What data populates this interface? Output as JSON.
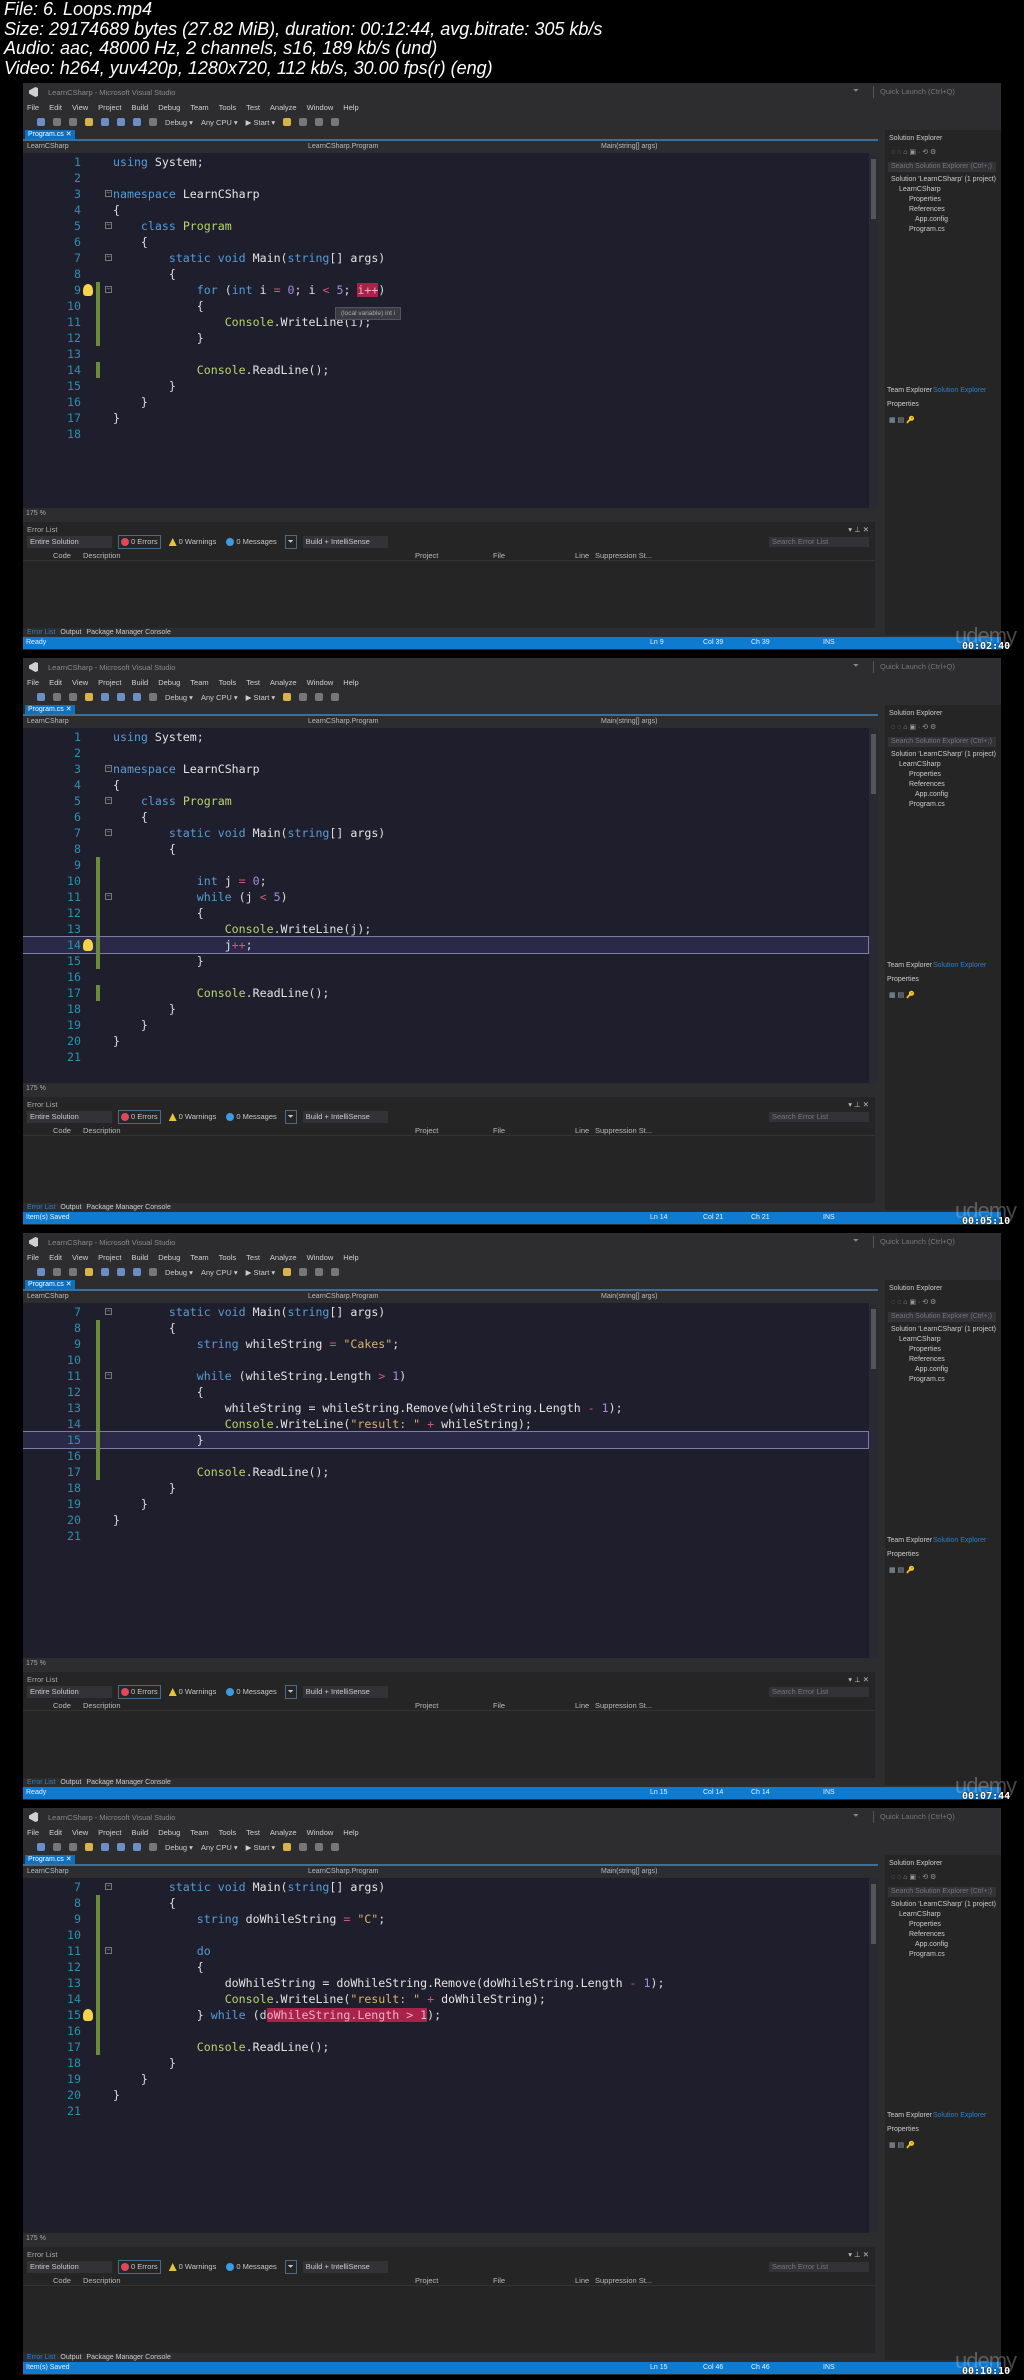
{
  "file_info": {
    "file": "File: 6. Loops.mp4",
    "size": "Size: 29174689 bytes (27.82 MiB), duration: 00:12:44, avg.bitrate: 305 kb/s",
    "audio": "Audio: aac, 48000 Hz, 2 channels, s16, 189 kb/s (und)",
    "video": "Video: h264, yuv420p, 1280x720, 112 kb/s, 30.00 fps(r) (eng)"
  },
  "ide": {
    "title": "LearnCSharp - Microsoft Visual Studio",
    "quick_launch": "Quick Launch (Ctrl+Q)",
    "menu": [
      "File",
      "Edit",
      "View",
      "Project",
      "Build",
      "Debug",
      "Team",
      "Tools",
      "Test",
      "Analyze",
      "Window",
      "Help"
    ],
    "config": "Debug ▾",
    "platform": "Any CPU ▾",
    "start": "▶ Start ▾",
    "doc_tab": "Program.cs  ✕",
    "nav_project": "LearnCSharp",
    "nav_class": "LearnCSharp.Program",
    "nav_member": "Main(string[] args)",
    "zoom": "175 %",
    "error_list": {
      "title": "Error List",
      "scope": "Entire Solution",
      "errors": "0 Errors",
      "warnings": "0 Warnings",
      "messages": "0 Messages",
      "build_filter": "Build + IntelliSense",
      "search": "Search Error List",
      "columns": [
        "Code",
        "Description",
        "Project",
        "File",
        "Line",
        "Suppression St..."
      ]
    },
    "bottom_tabs": [
      "Error List",
      "Output",
      "Package Manager Console"
    ],
    "solution_explorer": {
      "title": "Solution Explorer",
      "search": "Search Solution Explorer (Ctrl+;)",
      "tree": [
        "Solution 'LearnCSharp' (1 project)",
        "LearnCSharp",
        "Properties",
        "References",
        "App.config",
        "Program.cs"
      ],
      "tabs": [
        "Team Explorer",
        "Solution Explorer"
      ],
      "properties": "Properties"
    },
    "ins": "INS",
    "watermark": "udemy"
  },
  "frames": [
    {
      "timestamp": "00:02:40",
      "status": "Ready",
      "ln": "Ln 9",
      "col": "Col 39",
      "ch": "Ch 39",
      "first_line": 1,
      "current_line": 0,
      "bulb_line": 9,
      "changed_lines": [
        9,
        10,
        11,
        12,
        14
      ],
      "fold_lines": [
        3,
        5,
        7,
        9
      ],
      "tooltip": "(local variable) int i",
      "code": [
        [
          [
            "k",
            "using"
          ],
          [
            "p",
            " "
          ],
          [
            "i",
            "System"
          ],
          [
            "p",
            ";"
          ]
        ],
        [],
        [
          [
            "k",
            "namespace"
          ],
          [
            "p",
            " "
          ],
          [
            "i",
            "LearnCSharp"
          ]
        ],
        [
          [
            "p",
            "{"
          ]
        ],
        [
          [
            "p",
            "    "
          ],
          [
            "k",
            "class"
          ],
          [
            "p",
            " "
          ],
          [
            "t",
            "Program"
          ]
        ],
        [
          [
            "p",
            "    {"
          ]
        ],
        [
          [
            "p",
            "        "
          ],
          [
            "k",
            "static"
          ],
          [
            "p",
            " "
          ],
          [
            "k",
            "void"
          ],
          [
            "p",
            " "
          ],
          [
            "i",
            "Main"
          ],
          [
            "p",
            "("
          ],
          [
            "k",
            "string"
          ],
          [
            "p",
            "[] "
          ],
          [
            "i",
            "args"
          ],
          [
            "p",
            ")"
          ]
        ],
        [
          [
            "p",
            "        {"
          ]
        ],
        [
          [
            "p",
            "            "
          ],
          [
            "k",
            "for"
          ],
          [
            "p",
            " ("
          ],
          [
            "k",
            "int"
          ],
          [
            "i",
            " i "
          ],
          [
            "o",
            "="
          ],
          [
            "n",
            " 0"
          ],
          [
            "p",
            "; "
          ],
          [
            "i",
            "i "
          ],
          [
            "o",
            "<"
          ],
          [
            "n",
            " 5"
          ],
          [
            "p",
            "; "
          ],
          [
            "i",
            "i++",
            "h"
          ],
          [
            "p",
            ")"
          ]
        ],
        [
          [
            "p",
            "            {"
          ]
        ],
        [
          [
            "p",
            "                "
          ],
          [
            "t",
            "Console"
          ],
          [
            "p",
            "."
          ],
          [
            "i",
            "WriteLine"
          ],
          [
            "p",
            "(i);"
          ]
        ],
        [
          [
            "p",
            "            }"
          ]
        ],
        [],
        [
          [
            "p",
            "            "
          ],
          [
            "t",
            "Console"
          ],
          [
            "p",
            "."
          ],
          [
            "i",
            "ReadLine"
          ],
          [
            "p",
            "();"
          ]
        ],
        [
          [
            "p",
            "        }"
          ]
        ],
        [
          [
            "p",
            "    }"
          ]
        ],
        [
          [
            "p",
            "}"
          ]
        ],
        []
      ]
    },
    {
      "timestamp": "00:05:10",
      "status": "Item(s) Saved",
      "ln": "Ln 14",
      "col": "Col 21",
      "ch": "Ch 21",
      "first_line": 1,
      "current_line": 14,
      "bulb_line": 14,
      "changed_lines": [
        9,
        10,
        11,
        12,
        13,
        14,
        15,
        17
      ],
      "fold_lines": [
        3,
        5,
        7,
        11
      ],
      "code": [
        [
          [
            "k",
            "using"
          ],
          [
            "p",
            " "
          ],
          [
            "i",
            "System"
          ],
          [
            "p",
            ";"
          ]
        ],
        [],
        [
          [
            "k",
            "namespace"
          ],
          [
            "p",
            " "
          ],
          [
            "i",
            "LearnCSharp"
          ]
        ],
        [
          [
            "p",
            "{"
          ]
        ],
        [
          [
            "p",
            "    "
          ],
          [
            "k",
            "class"
          ],
          [
            "p",
            " "
          ],
          [
            "t",
            "Program"
          ]
        ],
        [
          [
            "p",
            "    {"
          ]
        ],
        [
          [
            "p",
            "        "
          ],
          [
            "k",
            "static"
          ],
          [
            "p",
            " "
          ],
          [
            "k",
            "void"
          ],
          [
            "p",
            " "
          ],
          [
            "i",
            "Main"
          ],
          [
            "p",
            "("
          ],
          [
            "k",
            "string"
          ],
          [
            "p",
            "[] "
          ],
          [
            "i",
            "args"
          ],
          [
            "p",
            ")"
          ]
        ],
        [
          [
            "p",
            "        {"
          ]
        ],
        [],
        [
          [
            "p",
            "            "
          ],
          [
            "k",
            "int"
          ],
          [
            "i",
            " j "
          ],
          [
            "o",
            "="
          ],
          [
            "n",
            " 0"
          ],
          [
            "p",
            ";"
          ]
        ],
        [
          [
            "p",
            "            "
          ],
          [
            "k",
            "while"
          ],
          [
            "p",
            " ("
          ],
          [
            "i",
            "j "
          ],
          [
            "o",
            "<"
          ],
          [
            "n",
            " 5"
          ],
          [
            "p",
            ")"
          ]
        ],
        [
          [
            "p",
            "            {"
          ]
        ],
        [
          [
            "p",
            "                "
          ],
          [
            "t",
            "Console"
          ],
          [
            "p",
            "."
          ],
          [
            "i",
            "WriteLine"
          ],
          [
            "p",
            "(j);"
          ]
        ],
        [
          [
            "p",
            "                "
          ],
          [
            "i",
            "j"
          ],
          [
            "o",
            "++"
          ],
          [
            "p",
            ";"
          ]
        ],
        [
          [
            "p",
            "            }"
          ]
        ],
        [],
        [
          [
            "p",
            "            "
          ],
          [
            "t",
            "Console"
          ],
          [
            "p",
            "."
          ],
          [
            "i",
            "ReadLine"
          ],
          [
            "p",
            "();"
          ]
        ],
        [
          [
            "p",
            "        }"
          ]
        ],
        [
          [
            "p",
            "    }"
          ]
        ],
        [
          [
            "p",
            "}"
          ]
        ],
        []
      ]
    },
    {
      "timestamp": "00:07:44",
      "status": "Ready",
      "ln": "Ln 15",
      "col": "Col 14",
      "ch": "Ch 14",
      "first_line": 7,
      "current_line": 15,
      "bulb_line": 0,
      "changed_lines": [
        8,
        9,
        10,
        11,
        12,
        13,
        14,
        15,
        16,
        17
      ],
      "fold_lines": [
        7,
        11
      ],
      "code": [
        [
          [
            "p",
            "        "
          ],
          [
            "k",
            "static"
          ],
          [
            "p",
            " "
          ],
          [
            "k",
            "void"
          ],
          [
            "p",
            " "
          ],
          [
            "i",
            "Main"
          ],
          [
            "p",
            "("
          ],
          [
            "k",
            "string"
          ],
          [
            "p",
            "[] "
          ],
          [
            "i",
            "args"
          ],
          [
            "p",
            ")"
          ]
        ],
        [
          [
            "p",
            "        {"
          ]
        ],
        [
          [
            "p",
            "            "
          ],
          [
            "k",
            "string"
          ],
          [
            "i",
            " whileString "
          ],
          [
            "o",
            "="
          ],
          [
            "p",
            " "
          ],
          [
            "s",
            "\"Cakes\""
          ],
          [
            "p",
            ";"
          ]
        ],
        [],
        [
          [
            "p",
            "            "
          ],
          [
            "k",
            "while"
          ],
          [
            "p",
            " ("
          ],
          [
            "i",
            "whileString.Length "
          ],
          [
            "o",
            ">"
          ],
          [
            "n",
            " 1"
          ],
          [
            "p",
            ")"
          ]
        ],
        [
          [
            "p",
            "            {"
          ]
        ],
        [
          [
            "p",
            "                "
          ],
          [
            "i",
            "whileString = whileString.Remove(whileString.Length "
          ],
          [
            "o",
            "-"
          ],
          [
            "n",
            " 1"
          ],
          [
            "p",
            ");"
          ]
        ],
        [
          [
            "p",
            "                "
          ],
          [
            "t",
            "Console"
          ],
          [
            "p",
            "."
          ],
          [
            "i",
            "WriteLine"
          ],
          [
            "p",
            "("
          ],
          [
            "s",
            "\"result: \""
          ],
          [
            "o",
            " +"
          ],
          [
            "i",
            " whileString"
          ],
          [
            "p",
            ");"
          ]
        ],
        [
          [
            "p",
            "            }"
          ]
        ],
        [],
        [
          [
            "p",
            "            "
          ],
          [
            "t",
            "Console"
          ],
          [
            "p",
            "."
          ],
          [
            "i",
            "ReadLine"
          ],
          [
            "p",
            "();"
          ]
        ],
        [
          [
            "p",
            "        }"
          ]
        ],
        [
          [
            "p",
            "    }"
          ]
        ],
        [
          [
            "p",
            "}"
          ]
        ],
        []
      ]
    },
    {
      "timestamp": "00:10:10",
      "status": "Item(s) Saved",
      "ln": "Ln 15",
      "col": "Col 46",
      "ch": "Ch 46",
      "first_line": 7,
      "current_line": 0,
      "bulb_line": 15,
      "changed_lines": [
        8,
        9,
        10,
        11,
        12,
        13,
        14,
        15,
        16,
        17
      ],
      "fold_lines": [
        7,
        11
      ],
      "code": [
        [
          [
            "p",
            "        "
          ],
          [
            "k",
            "static"
          ],
          [
            "p",
            " "
          ],
          [
            "k",
            "void"
          ],
          [
            "p",
            " "
          ],
          [
            "i",
            "Main"
          ],
          [
            "p",
            "("
          ],
          [
            "k",
            "string"
          ],
          [
            "p",
            "[] "
          ],
          [
            "i",
            "args"
          ],
          [
            "p",
            ")"
          ]
        ],
        [
          [
            "p",
            "        {"
          ]
        ],
        [
          [
            "p",
            "            "
          ],
          [
            "k",
            "string"
          ],
          [
            "i",
            " doWhileString "
          ],
          [
            "o",
            "="
          ],
          [
            "p",
            " "
          ],
          [
            "s",
            "\"C\""
          ],
          [
            "p",
            ";"
          ]
        ],
        [],
        [
          [
            "p",
            "            "
          ],
          [
            "k",
            "do"
          ]
        ],
        [
          [
            "p",
            "            {"
          ]
        ],
        [
          [
            "p",
            "                "
          ],
          [
            "i",
            "doWhileString = doWhileString.Remove(doWhileString.Length "
          ],
          [
            "o",
            "-"
          ],
          [
            "n",
            " 1"
          ],
          [
            "p",
            ");"
          ]
        ],
        [
          [
            "p",
            "                "
          ],
          [
            "t",
            "Console"
          ],
          [
            "p",
            "."
          ],
          [
            "i",
            "WriteLine"
          ],
          [
            "p",
            "("
          ],
          [
            "s",
            "\"result: \""
          ],
          [
            "o",
            " +"
          ],
          [
            "i",
            " doWhileString"
          ],
          [
            "p",
            ");"
          ]
        ],
        [
          [
            "p",
            "            } "
          ],
          [
            "k",
            "while"
          ],
          [
            "p",
            " (d"
          ],
          [
            "i",
            "oWhileString.Length > 1",
            "h"
          ],
          [
            "p",
            ");"
          ]
        ],
        [],
        [
          [
            "p",
            "            "
          ],
          [
            "t",
            "Console"
          ],
          [
            "p",
            "."
          ],
          [
            "i",
            "ReadLine"
          ],
          [
            "p",
            "();"
          ]
        ],
        [
          [
            "p",
            "        }"
          ]
        ],
        [
          [
            "p",
            "    }"
          ]
        ],
        [
          [
            "p",
            "}"
          ]
        ],
        []
      ]
    }
  ]
}
